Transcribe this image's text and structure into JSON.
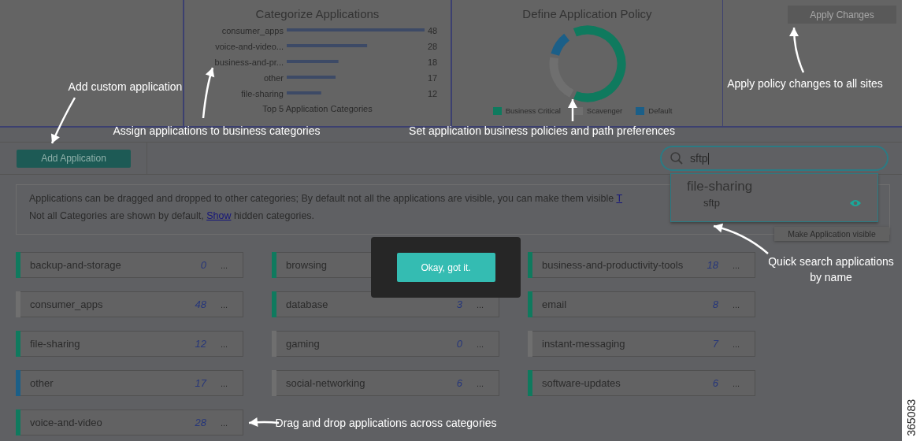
{
  "categorize_panel": {
    "title": "Categorize Applications",
    "chart_data": {
      "type": "bar",
      "orientation": "horizontal",
      "title": "Top 5 Application Categories",
      "categories": [
        "consumer_apps",
        "voice-and-video...",
        "business-and-pr...",
        "other",
        "file-sharing"
      ],
      "values": [
        48,
        28,
        18,
        17,
        12
      ],
      "data_labels": true
    }
  },
  "policy_panel": {
    "title": "Define Application Policy",
    "legend": [
      {
        "label": "Business Critical",
        "color": "#0f7a5e"
      },
      {
        "label": "Scavenger",
        "color": "#6f6f6f"
      },
      {
        "label": "Default",
        "color": "#1b5f88"
      }
    ]
  },
  "apply_button": {
    "label": "Apply Changes",
    "disabled": true
  },
  "add_button": {
    "label": "Add Application"
  },
  "search": {
    "value": "sftp",
    "results": [
      {
        "group": "file-sharing",
        "items": [
          {
            "name": "sftp",
            "visible": true
          }
        ]
      }
    ],
    "tooltip": "Make Application visible"
  },
  "info": {
    "line_1": "Applications can be dragged and dropped to other categories; By default not all the applications are visible, you can make them visible",
    "line_1_link": "T",
    "line_2_before": "Not all Categories are shown by default,",
    "line_2_link": "Show",
    "line_2_after": "hidden categories."
  },
  "category_columns": [
    [
      {
        "name": "backup-and-storage",
        "count": "0",
        "color": "#0f7a5e"
      },
      {
        "name": "consumer_apps",
        "count": "48",
        "color": "#6f6f6f"
      },
      {
        "name": "file-sharing",
        "count": "12",
        "color": "#0f7a5e"
      },
      {
        "name": "other",
        "count": "17",
        "color": "#1b5f88"
      },
      {
        "name": "voice-and-video",
        "count": "28",
        "color": "#0f7a5e"
      }
    ],
    [
      {
        "name": "browsing",
        "color": "#0f7a5e"
      },
      {
        "name": "database",
        "count": "3",
        "color": "#0f7a5e"
      },
      {
        "name": "gaming",
        "count": "0",
        "color": "#6f6f6f"
      },
      {
        "name": "social-networking",
        "count": "6",
        "color": "#6f6f6f"
      }
    ],
    [
      {
        "name": "business-and-productivity-tools",
        "count": "18",
        "color": "#0f7a5e"
      },
      {
        "name": "email",
        "count": "8",
        "color": "#0f7a5e"
      },
      {
        "name": "instant-messaging",
        "count": "7",
        "color": "#6f6f6f"
      },
      {
        "name": "software-updates",
        "count": "6",
        "color": "#0f7a5e"
      }
    ]
  ],
  "more_label": "...",
  "modal": {
    "button": "Okay, got it."
  },
  "callouts": [
    {
      "text": "Add custom application"
    },
    {
      "text": "Assign applications to\nbusiness categories"
    },
    {
      "text": "Set application business\npolicies and path preferences"
    },
    {
      "text": "Apply policy changes\nto all sites"
    },
    {
      "text": "Drag and drop applications across categories"
    },
    {
      "text": "Quick search applications by name"
    }
  ],
  "figure_number": "365083"
}
